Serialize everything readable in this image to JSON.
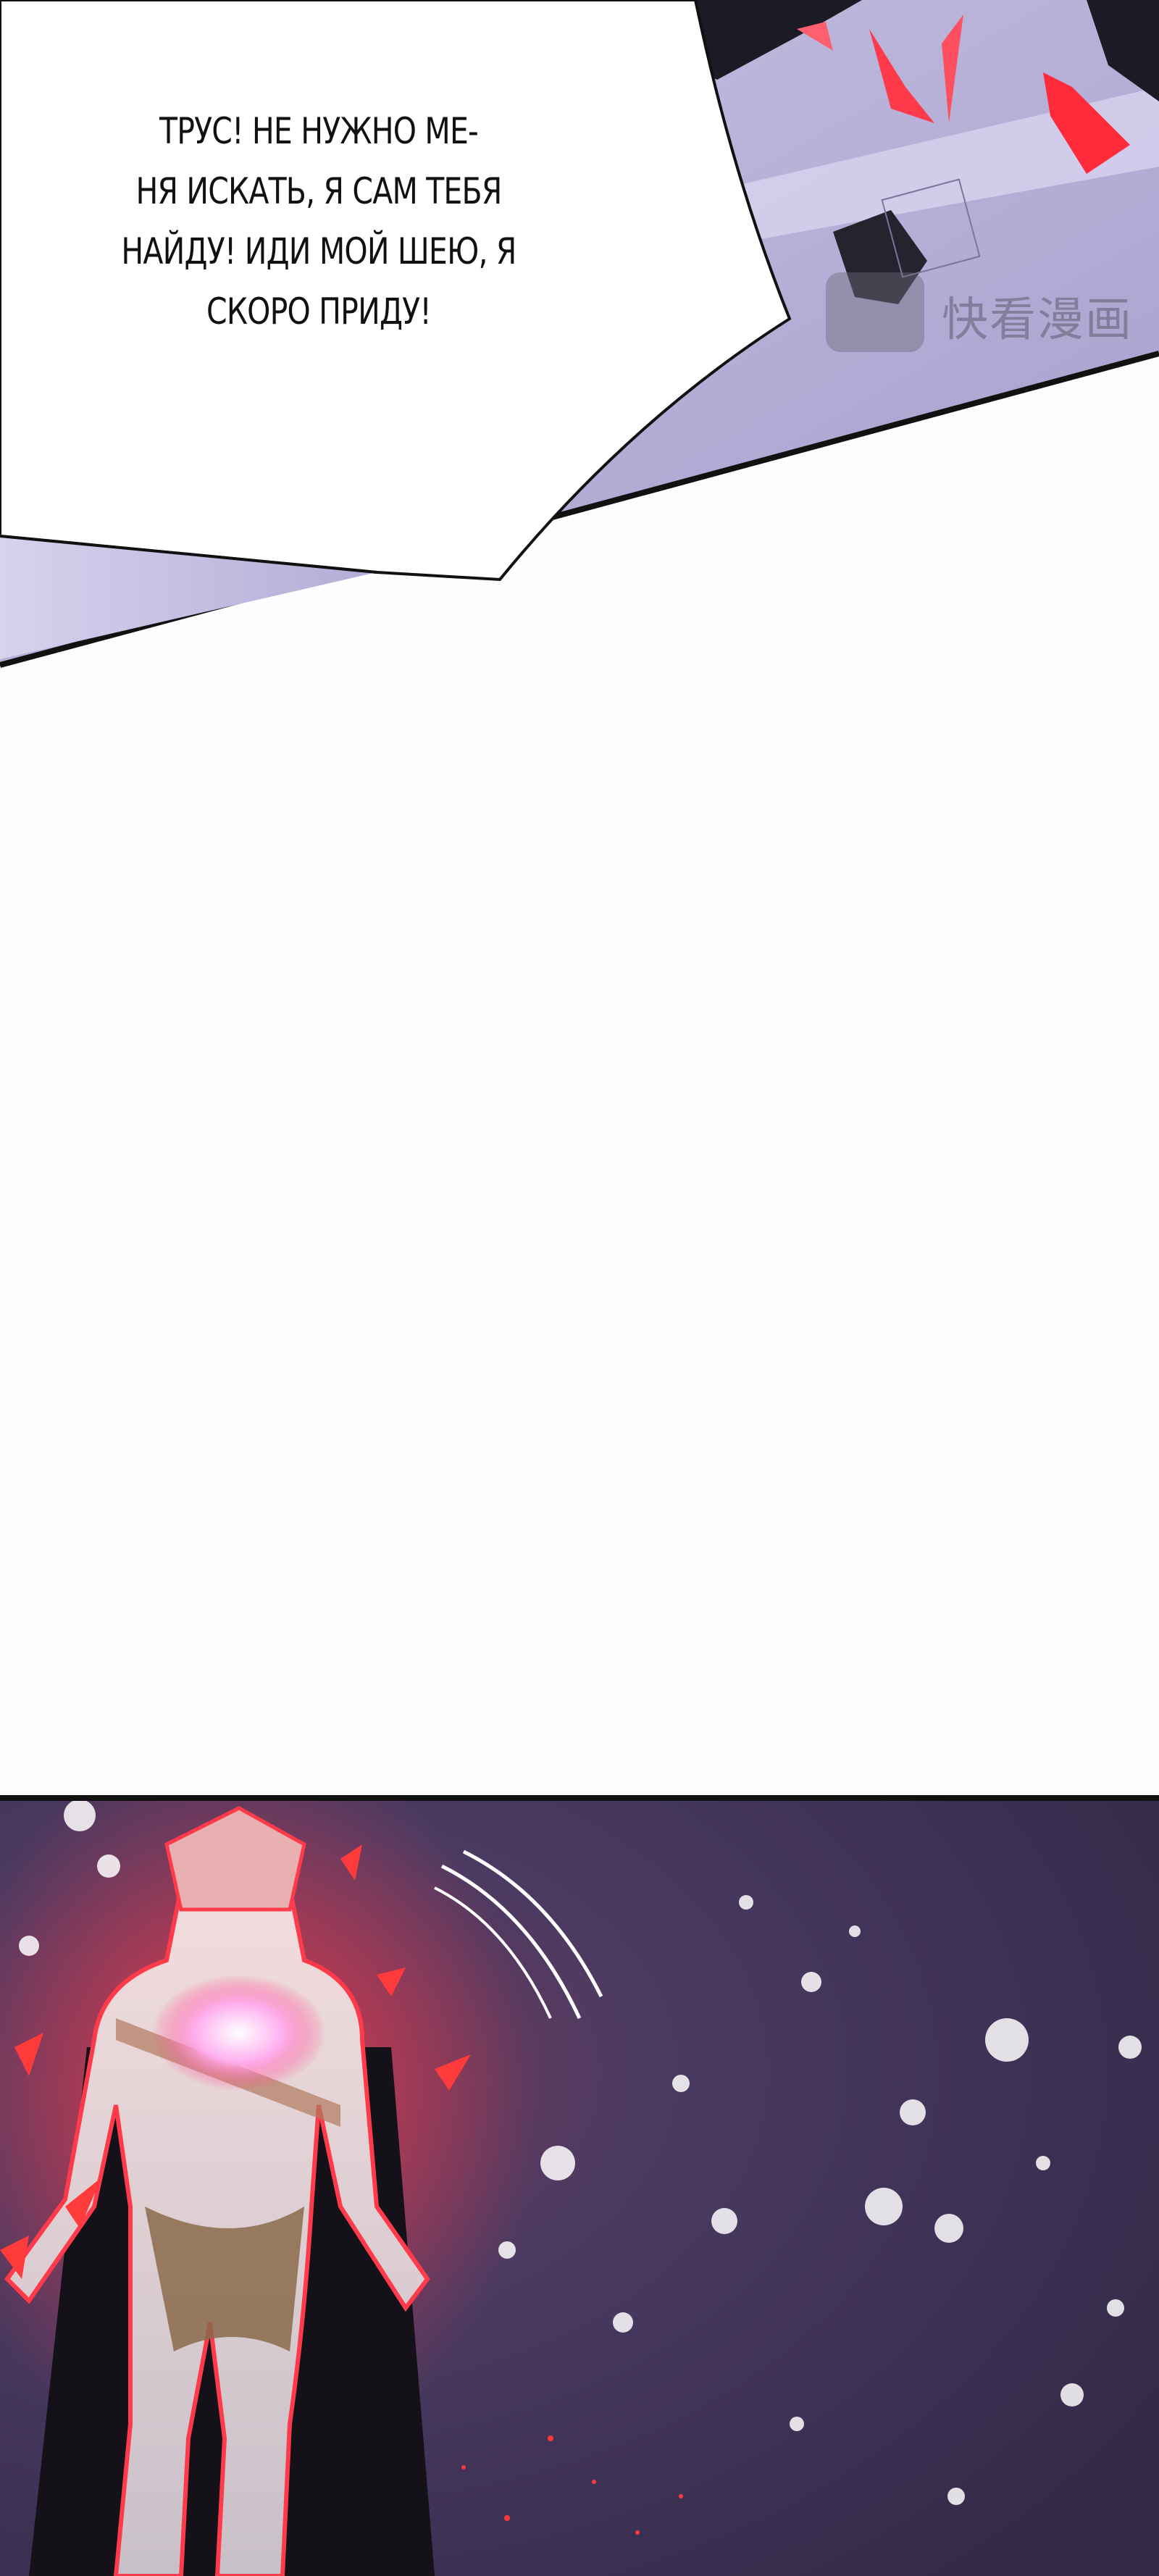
{
  "speech_bubble": {
    "text": "ТРУС! НЕ НУЖНО МЕ-\nНЯ ИСКАТЬ, Я САМ ТЕБЯ\nНАЙДУ! ИДИ МОЙ ШЕЮ, Я\nСКОРО ПРИДУ!"
  },
  "watermark": {
    "text": "快看漫画"
  },
  "colors": {
    "panel_lavender": "#b8b2d6",
    "panel_dark_purple": "#3a3150",
    "glow_red": "#ff2a3a",
    "ink": "#111111"
  }
}
